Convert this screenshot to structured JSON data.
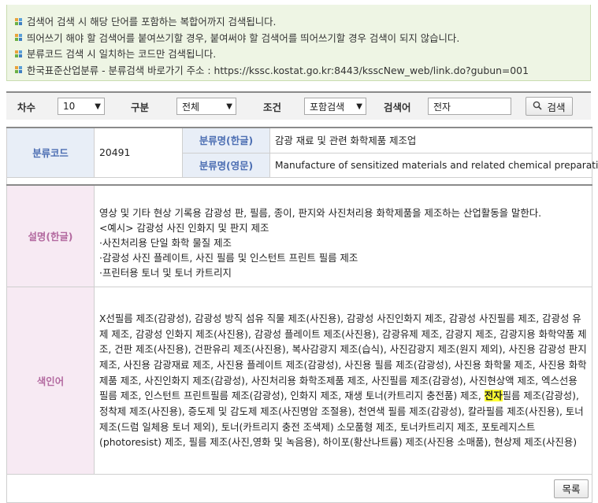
{
  "notice": {
    "lines": [
      "검색어 검색 시 해당 단어를 포함하는 복합어까지 검색됩니다.",
      "띄어쓰기 해야 할 검색어를 붙여쓰기할 경우, 붙여써야 할 검색어를 띄어쓰기할 경우 검색이 되지 않습니다.",
      "분류코드 검색 시 일치하는 코드만 검색됩니다.",
      "한국표준산업분류 - 분류검색 바로가기 주소 : https://kssc.kostat.go.kr:8443/ksscNew_web/link.do?gubun=001"
    ]
  },
  "search": {
    "degree_label": "차수",
    "degree_value": "10",
    "category_label": "구분",
    "category_value": "전체",
    "condition_label": "조건",
    "condition_value": "포함검색",
    "keyword_label": "검색어",
    "keyword_value": "전자",
    "button_label": "검색"
  },
  "detail": {
    "code_label": "분류코드",
    "code_value": "20491",
    "name_kr_label": "분류명(한글)",
    "name_kr_value": "감광 재료 및 관련 화학제품 제조업",
    "name_en_label": "분류명(영문)",
    "name_en_value": "Manufacture of sensitized materials and related chemical preparations",
    "desc_label": "설명(한글)",
    "desc_lines": [
      "영상 및 기타 현상 기록용 감광성 판, 필름, 종이, 판지와 사진처리용 화학제품을 제조하는 산업활동을 말한다.",
      "<예시> 감광성 사진 인화지 및 판지 제조",
      "·사진처리용 단일 화학 물질 제조",
      "·감광성 사진 플레이트, 사진 필름 및 인스턴트 프린트 필름 제조",
      "·프린터용 토너 및 토너 카트리지"
    ],
    "index_label": "색인어",
    "index_before": "X선필름 제조(감광성), 감광성 방직 섬유 직물 제조(사진용), 감광성 사진인화지 제조, 감광성 사진필름 제조, 감광성 유제 제조, 감광성 인화지 제조(사진용), 감광성 플레이트 제조(사진용), 감광유제 제조, 감광지 제조, 감광지용 화학약품 제조, 건판 제조(사진용), 건판유리 제조(사진용), 복사감광지 제조(습식), 사진감광지 제조(원지 제외), 사진용 감광성 판지 제조, 사진용 감광재료 제조, 사진용 플레이트 제조(감광성), 사진용 필름 제조(감광성), 사진용 화학물 제조, 사진용 화학제품 제조, 사진인화지 제조(감광성), 사진처리용 화학조제품 제조, 사진필름 제조(감광성), 사진현상액 제조, 엑스선용 필름 제조, 인스턴트 프린트필름 제조(감광성), 인화지 제조, 재생 토너(카트리지 충전품) 제조, ",
    "index_highlight": "전자",
    "index_after": "필름 제조(감광성), 정착제 제조(사진용), 증도제 및 감도제 제조(사진명암 조절용), 천연색 필름 제조(감광성), 칼라필름 제조(사진용), 토너 제조(드럼 일체용 토너 제외), 토너(카트리지 충전 조색제) 소모품형 제조, 토너카트리지 제조, 포토레지스트(photoresist) 제조, 필름 제조(사진,영화 및 녹음용), 하이포(황산나트륨) 제조(사진용 소매품), 현상제 제조(사진용)",
    "list_button": "목록"
  }
}
